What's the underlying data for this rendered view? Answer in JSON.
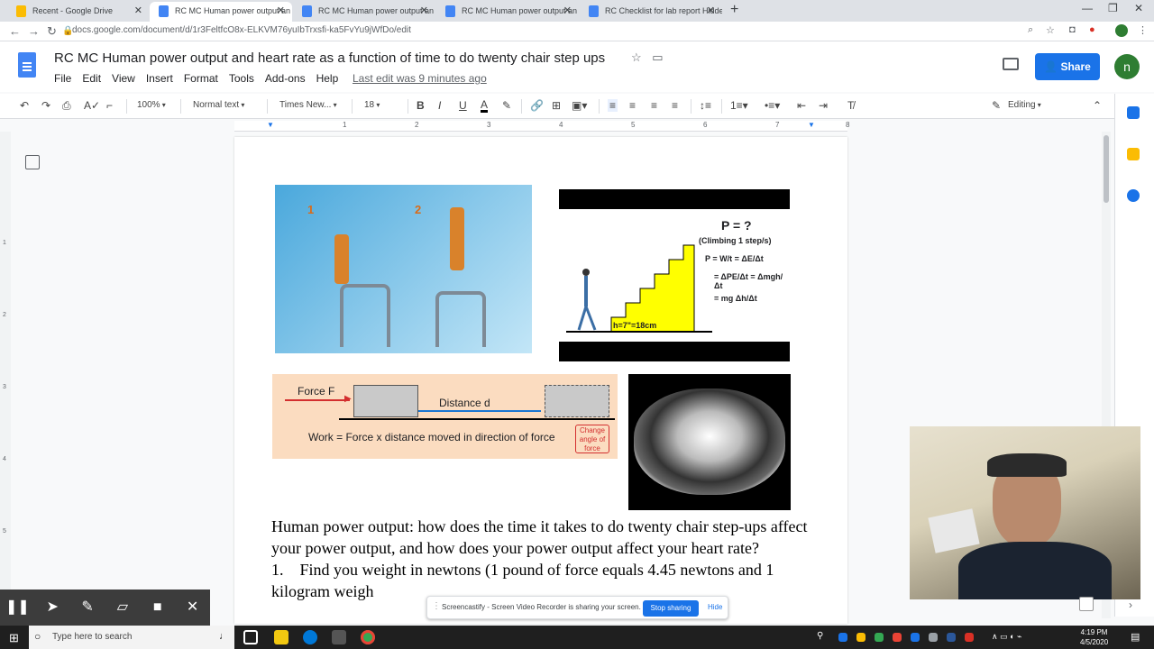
{
  "browser": {
    "tabs": [
      {
        "label": "Recent - Google Drive",
        "active": false
      },
      {
        "label": "RC MC Human power output an",
        "active": true
      },
      {
        "label": "RC MC Human power output an",
        "active": false
      },
      {
        "label": "RC MC Human power output an",
        "active": false
      },
      {
        "label": "RC Checklist for lab report Hidde",
        "active": false
      }
    ],
    "url": "docs.google.com/document/d/1r3FeltfcO8x-ELKVM76yuIbTrxsfi-ka5FvYu9jWfDo/edit"
  },
  "doc": {
    "title": "RC MC Human power output and heart rate as a function of time to do twenty chair step ups",
    "menus": [
      "File",
      "Edit",
      "View",
      "Insert",
      "Format",
      "Tools",
      "Add-ons",
      "Help"
    ],
    "last_edit": "Last edit was 9 minutes ago",
    "share_label": "Share",
    "avatar_letter": "n"
  },
  "toolbar": {
    "zoom": "100%",
    "style": "Normal text",
    "font": "Times New...",
    "font_size": "18",
    "mode": "Editing"
  },
  "ruler": {
    "marks": [
      "1",
      "2",
      "3",
      "4",
      "5",
      "6",
      "7",
      "8"
    ],
    "left_marks": [
      "1",
      "2",
      "3",
      "4",
      "5"
    ]
  },
  "figures": {
    "stepup_labels": [
      "1",
      "2"
    ],
    "stairs": {
      "p_question": "P = ?",
      "climbing": "(Climbing 1 step/s)",
      "eq1": "P = W/t = ΔE/Δt",
      "eq2": "= ΔPE/Δt = Δmgh/Δt",
      "eq3": "= mg Δh/Δt",
      "height": "h=7\"=18cm"
    },
    "work": {
      "force": "Force F",
      "distance": "Distance d",
      "formula": "Work = Force x distance moved in direction of force",
      "note": "Change angle of force"
    }
  },
  "body": {
    "paragraph": "Human power output: how does the time it takes to do twenty chair step-ups affect your power output, and how does your power output affect your heart rate?",
    "item1_num": "1.",
    "item1": "Find you weight in newtons (1 pound of force equals 4.45 newtons and 1 kilogram weigh"
  },
  "screencastify": {
    "banner": "Screencastify - Screen Video Recorder is sharing your screen.",
    "stop": "Stop sharing",
    "hide": "Hide"
  },
  "taskbar": {
    "search_placeholder": "Type here to search",
    "time": "4:19 PM",
    "date": "4/5/2020"
  }
}
